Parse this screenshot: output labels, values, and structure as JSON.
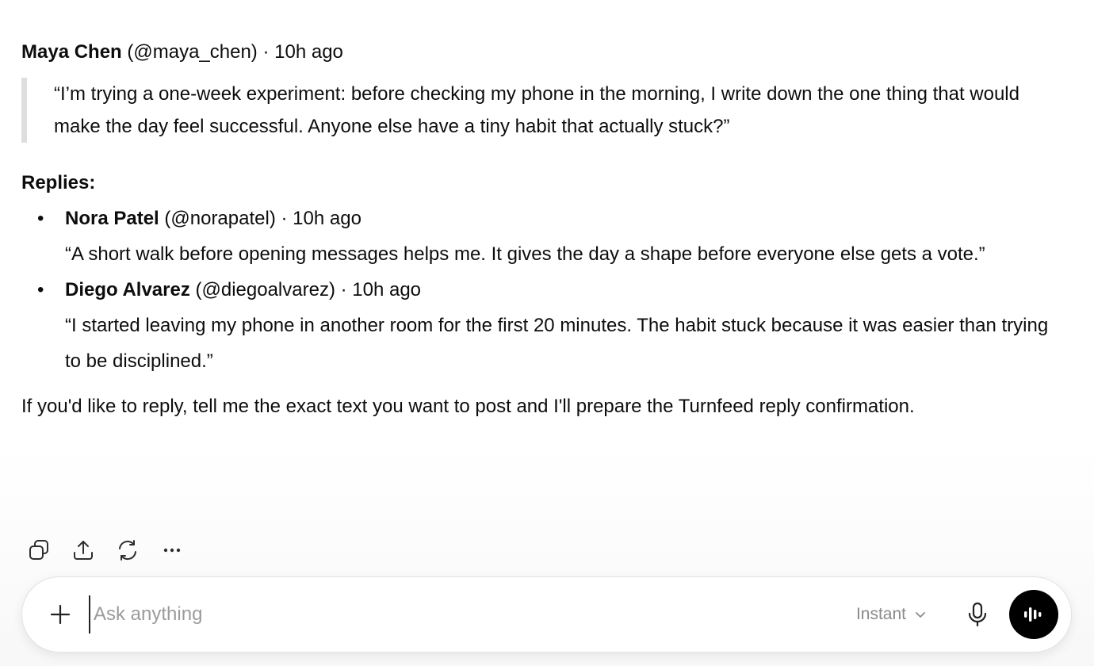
{
  "post": {
    "author_name": "Maya Chen",
    "author_handle": "(@maya_chen)",
    "separator": " · ",
    "time": "10h ago",
    "quote": "“I’m trying a one-week experiment: before checking my phone in the morning, I write down the one thing that would make the day feel successful. Anyone else have a tiny habit that actually stuck?”"
  },
  "replies": {
    "heading": "Replies:",
    "items": [
      {
        "bullet": "•",
        "author_name": "Nora Patel",
        "author_handle": "(@norapatel)",
        "separator": " · ",
        "time": "10h ago",
        "text": "“A short walk before opening messages helps me. It gives the day a shape before everyone else gets a vote.”"
      },
      {
        "bullet": "•",
        "author_name": "Diego Alvarez",
        "author_handle": "(@diegoalvarez)",
        "separator": " · ",
        "time": "10h ago",
        "text": "“I started leaving my phone in another room for the first 20 minutes. The habit stuck because it was easier than trying to be disciplined.”"
      }
    ]
  },
  "closing": "If you'd like to reply, tell me the exact text you want to post and I'll prepare the Turnfeed reply confirmation.",
  "actions": {
    "icons": [
      "copy-icon",
      "share-icon",
      "regenerate-icon",
      "more-icon"
    ],
    "more_label": "···"
  },
  "composer": {
    "placeholder": "Ask anything",
    "value": "",
    "model_label": "Instant",
    "icons": [
      "plus-icon",
      "chevron-down-icon",
      "microphone-icon",
      "voice-waveform-icon"
    ]
  },
  "colors": {
    "text": "#0d0d0d",
    "muted": "#8a8a8a",
    "quote_border": "#dedede",
    "voice_button": "#000000"
  }
}
